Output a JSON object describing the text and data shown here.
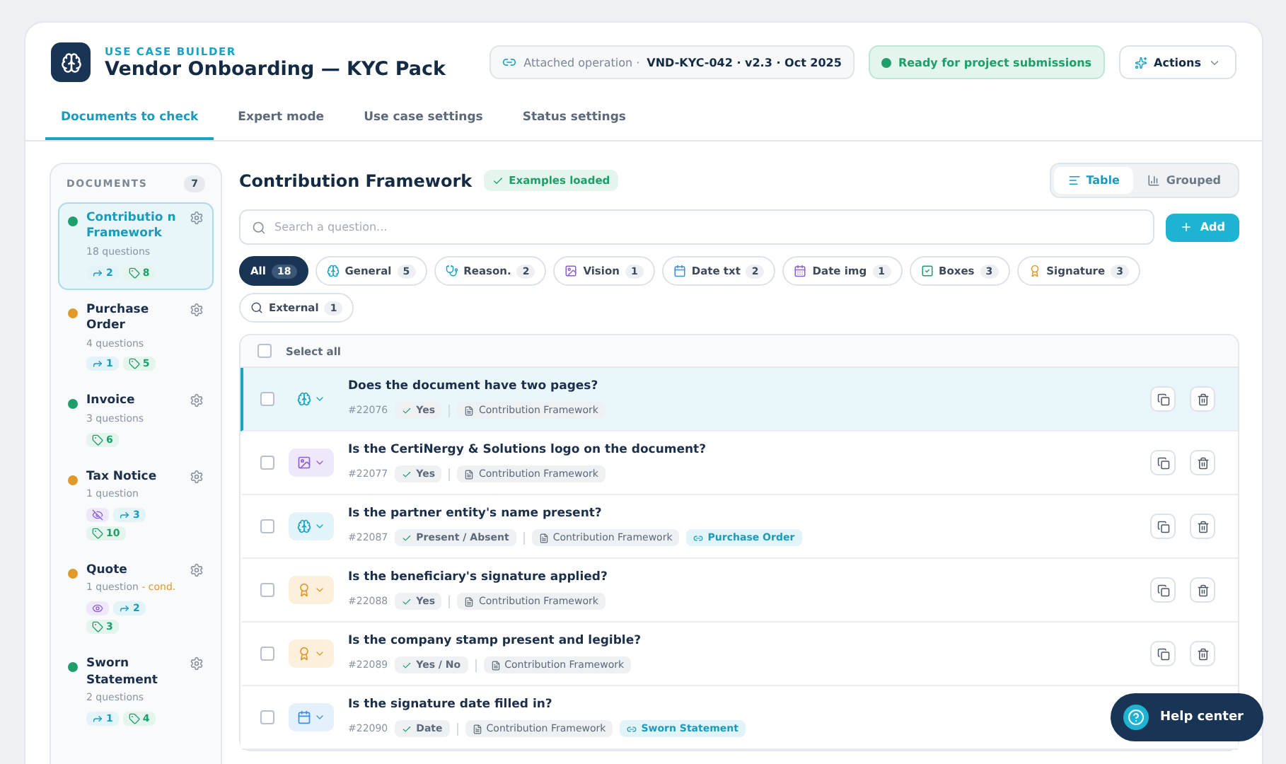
{
  "header": {
    "eyebrow": "USE CASE BUILDER",
    "title": "Vendor Onboarding — KYC Pack",
    "operation_label": "Attached operation ·",
    "operation_value": "VND-KYC-042 · v2.3 · Oct 2025",
    "status": "Ready for project submissions",
    "actions": "Actions"
  },
  "tabs": [
    {
      "label": "Documents to check",
      "selected": true
    },
    {
      "label": "Expert mode",
      "selected": false
    },
    {
      "label": "Use case settings",
      "selected": false
    },
    {
      "label": "Status settings",
      "selected": false
    }
  ],
  "sidebar": {
    "title": "DOCUMENTS",
    "count": "7",
    "items": [
      {
        "name": "Contributio n Framework",
        "questions": "18 questions",
        "color": "#1e9e6a",
        "selected": true,
        "badges": [
          {
            "kind": "link",
            "text": "2"
          },
          {
            "kind": "tag",
            "text": "8"
          }
        ]
      },
      {
        "name": "Purchase Order",
        "questions": "4 questions",
        "color": "#e0992b",
        "selected": false,
        "badges": [
          {
            "kind": "link",
            "text": "1"
          },
          {
            "kind": "tag",
            "text": "5"
          }
        ]
      },
      {
        "name": "Invoice",
        "questions": "3 questions",
        "color": "#1e9e6a",
        "selected": false,
        "badges": [
          {
            "kind": "tag",
            "text": "6"
          }
        ]
      },
      {
        "name": "Tax Notice",
        "questions": "1 question",
        "color": "#e0992b",
        "selected": false,
        "badges": [
          {
            "kind": "hidden"
          },
          {
            "kind": "link",
            "text": "3"
          },
          {
            "kind": "tag",
            "text": "10"
          }
        ]
      },
      {
        "name": "Quote",
        "questions": "1 question",
        "note": "- cond.",
        "color": "#e0992b",
        "selected": false,
        "badges": [
          {
            "kind": "visible"
          },
          {
            "kind": "link",
            "text": "2"
          },
          {
            "kind": "tag",
            "text": "3"
          }
        ]
      },
      {
        "name": "Sworn Statement",
        "questions": "2 questions",
        "color": "#1e9e6a",
        "selected": false,
        "badges": [
          {
            "kind": "link",
            "text": "1"
          },
          {
            "kind": "tag",
            "text": "4"
          }
        ]
      }
    ]
  },
  "main": {
    "title": "Contribution Framework",
    "examples": "Examples loaded",
    "views": [
      {
        "label": "Table",
        "kind": "table",
        "selected": true
      },
      {
        "label": "Grouped",
        "kind": "grouped",
        "selected": false
      }
    ],
    "search": {
      "placeholder": "Search a question..."
    },
    "add": "Add",
    "filters": [
      {
        "kind": "all",
        "label": "All",
        "count": "18",
        "selected": true
      },
      {
        "kind": "general",
        "label": "General",
        "count": "5",
        "selected": false
      },
      {
        "kind": "reason",
        "label": "Reason.",
        "count": "2",
        "selected": false
      },
      {
        "kind": "vision",
        "label": "Vision",
        "count": "1",
        "selected": false
      },
      {
        "kind": "date_txt",
        "label": "Date txt",
        "count": "2",
        "selected": false
      },
      {
        "kind": "date_img",
        "label": "Date img",
        "count": "1",
        "selected": false
      },
      {
        "kind": "boxes",
        "label": "Boxes",
        "count": "3",
        "selected": false
      },
      {
        "kind": "signature",
        "label": "Signature",
        "count": "3",
        "selected": false
      },
      {
        "kind": "external",
        "label": "External",
        "count": "1",
        "selected": false
      }
    ],
    "select_all": {
      "label": "Select all",
      "checked": false
    },
    "rows": [
      {
        "kind": "general",
        "question": "Does the document have two pages?",
        "id": "#22076",
        "answer": "Yes",
        "document": "Contribution Framework",
        "selected": true,
        "checked": false
      },
      {
        "kind": "vision",
        "question": "Is the CertiNergy & Solutions logo on the document?",
        "id": "#22077",
        "answer": "Yes",
        "document": "Contribution Framework",
        "selected": false,
        "checked": false
      },
      {
        "kind": "general",
        "question": "Is the partner entity's name present?",
        "id": "#22087",
        "answer": "Present / Absent",
        "document": "Contribution Framework",
        "linked": "Purchase Order",
        "selected": false,
        "checked": false
      },
      {
        "kind": "signature",
        "question": "Is the beneficiary's signature applied?",
        "id": "#22088",
        "answer": "Yes",
        "document": "Contribution Framework",
        "selected": false,
        "checked": false
      },
      {
        "kind": "signature",
        "question": "Is the company stamp present and legible?",
        "id": "#22089",
        "answer": "Yes / No",
        "document": "Contribution Framework",
        "selected": false,
        "checked": false
      },
      {
        "kind": "date_txt",
        "question": "Is the signature date filled in?",
        "id": "#22090",
        "answer": "Date",
        "document": "Contribution Framework",
        "linked": "Sworn Statement",
        "selected": false,
        "checked": false
      }
    ]
  },
  "help": "Help center"
}
